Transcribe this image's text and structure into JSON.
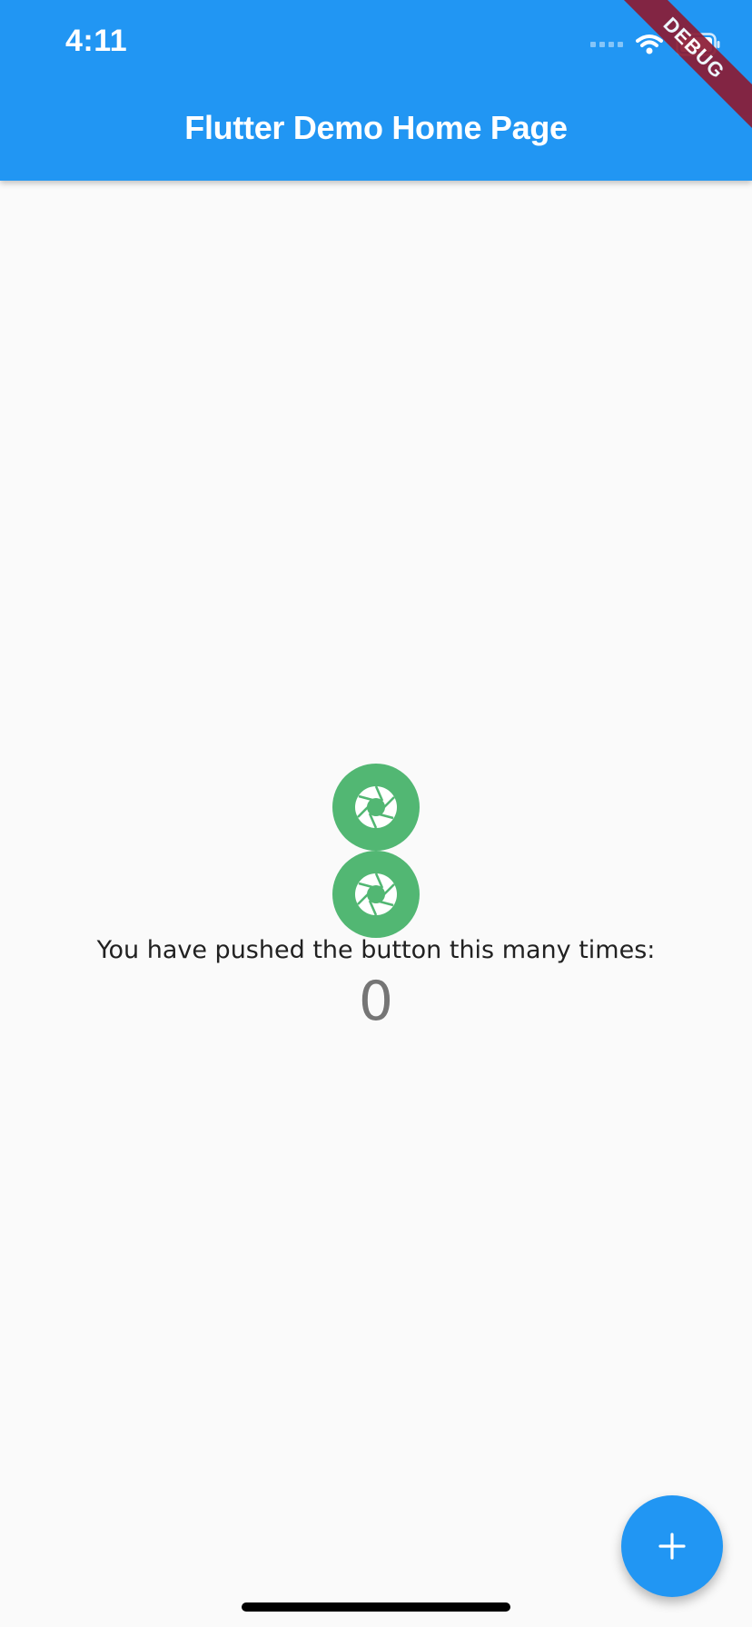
{
  "status_bar": {
    "time": "4:11",
    "icons": [
      "signal-dots-icon",
      "wifi-icon",
      "battery-icon"
    ]
  },
  "app_bar": {
    "title": "Flutter Demo Home Page",
    "background": "#2196f3"
  },
  "debug_banner": {
    "label": "DEBUG",
    "color": "#8b1c35"
  },
  "content": {
    "shutter_icons": [
      "camera-shutter-icon",
      "camera-shutter-icon"
    ],
    "shutter_color": "#52b773",
    "counter_label": "You have pushed the button this many times:",
    "counter_value": "0"
  },
  "fab": {
    "icon": "add-icon",
    "color": "#2196f3"
  }
}
